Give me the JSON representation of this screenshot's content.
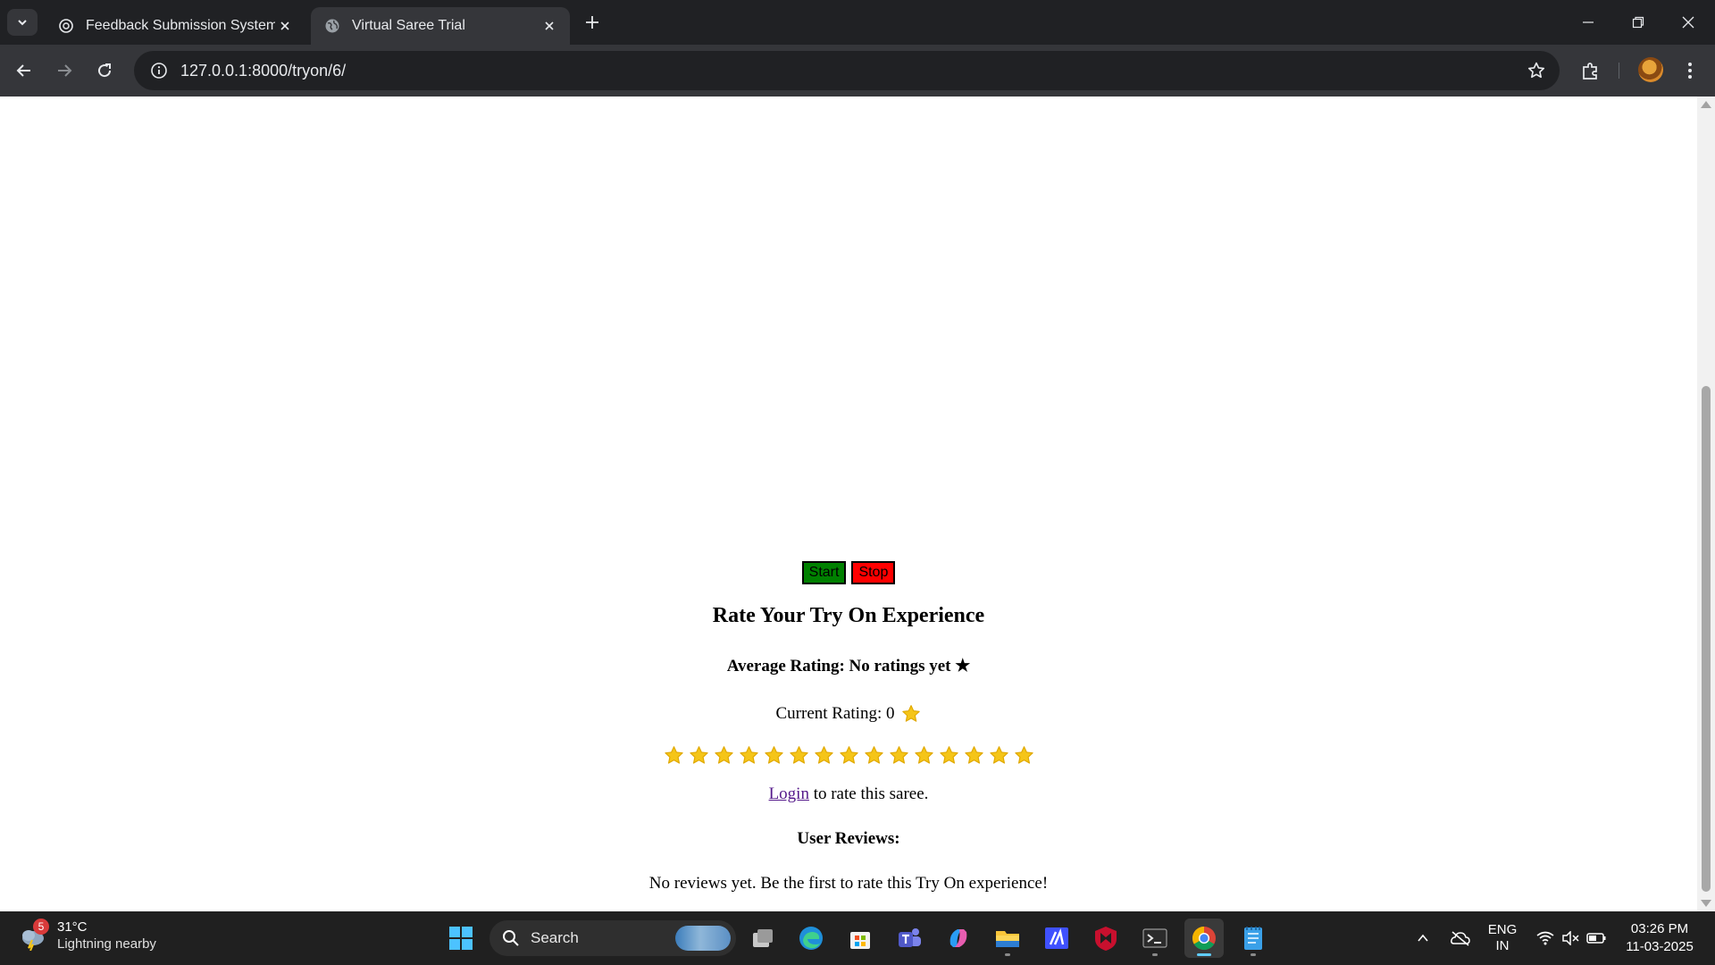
{
  "browser": {
    "tabs": [
      {
        "title": "Feedback Submission System",
        "active": false
      },
      {
        "title": "Virtual Saree Trial",
        "active": true
      }
    ],
    "url": "127.0.0.1:8000/tryon/6/"
  },
  "page": {
    "buttons": {
      "start_label": "Start",
      "stop_label": "Stop"
    },
    "heading": "Rate Your Try On Experience",
    "average_rating": "Average Rating: No ratings yet ★",
    "current_rating_label": "Current Rating: 0",
    "star_count": 15,
    "login_link": "Login",
    "login_suffix": " to rate this saree.",
    "reviews_heading": "User Reviews:",
    "no_reviews": "No reviews yet. Be the first to rate this Try On experience!",
    "colors": {
      "start": "#008000",
      "stop": "#ff0000",
      "star": "#f5c518"
    }
  },
  "taskbar": {
    "weather": {
      "temp": "31°C",
      "condition": "Lightning nearby",
      "badge": "5"
    },
    "search_label": "Search",
    "tray": {
      "lang_top": "ENG",
      "lang_bottom": "IN"
    },
    "clock": {
      "time": "03:26 PM",
      "date": "11-03-2025"
    }
  }
}
